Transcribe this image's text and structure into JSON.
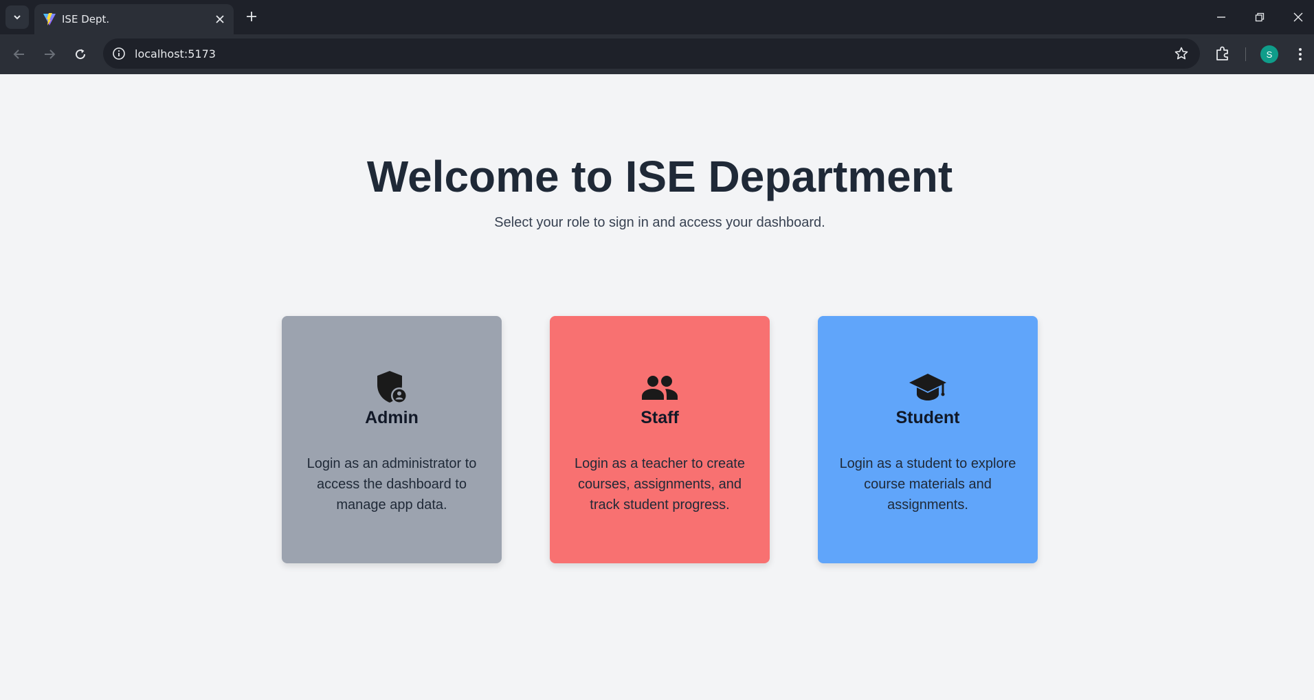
{
  "browser": {
    "tab_title": "ISE Dept.",
    "url": "localhost:5173",
    "profile_initial": "S",
    "colors": {
      "chrome_dark": "#1e2129",
      "chrome_mid": "#2b2f37",
      "avatar": "#0f9d8a"
    }
  },
  "page": {
    "title": "Welcome to ISE Department",
    "subtitle": "Select your role to sign in and access your dashboard."
  },
  "roles": [
    {
      "title": "Admin",
      "icon": "admin-shield-icon",
      "color": "#9ca3af",
      "description": "Login as an administrator to access the dashboard to manage app data."
    },
    {
      "title": "Staff",
      "icon": "people-icon",
      "color": "#f87171",
      "description": "Login as a teacher to create courses, assignments, and track student progress."
    },
    {
      "title": "Student",
      "icon": "graduation-cap-icon",
      "color": "#60a5fa",
      "description": "Login as a student to explore course materials and assignments."
    }
  ]
}
